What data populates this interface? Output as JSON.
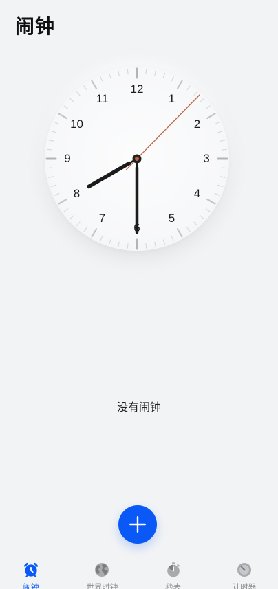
{
  "header": {
    "title": "闹钟"
  },
  "clock": {
    "numerals": [
      "12",
      "1",
      "2",
      "3",
      "4",
      "5",
      "6",
      "7",
      "8",
      "9",
      "10",
      "11"
    ],
    "hour": 8.0,
    "minute": 30,
    "second": 7.4
  },
  "empty_state": {
    "text": "没有闹钟"
  },
  "add_button": {
    "icon": "plus-icon"
  },
  "bottom_nav": {
    "items": [
      {
        "label": "闹钟",
        "icon": "alarm-clock-icon",
        "active": true
      },
      {
        "label": "世界时钟",
        "icon": "globe-icon",
        "active": false
      },
      {
        "label": "秒表",
        "icon": "stopwatch-icon",
        "active": false
      },
      {
        "label": "计时器",
        "icon": "timer-icon",
        "active": false
      }
    ]
  },
  "colors": {
    "accent": "#0a59f7",
    "background": "#f1f3f5",
    "second_hand": "#c0623f",
    "inactive": "#8e8f93"
  }
}
